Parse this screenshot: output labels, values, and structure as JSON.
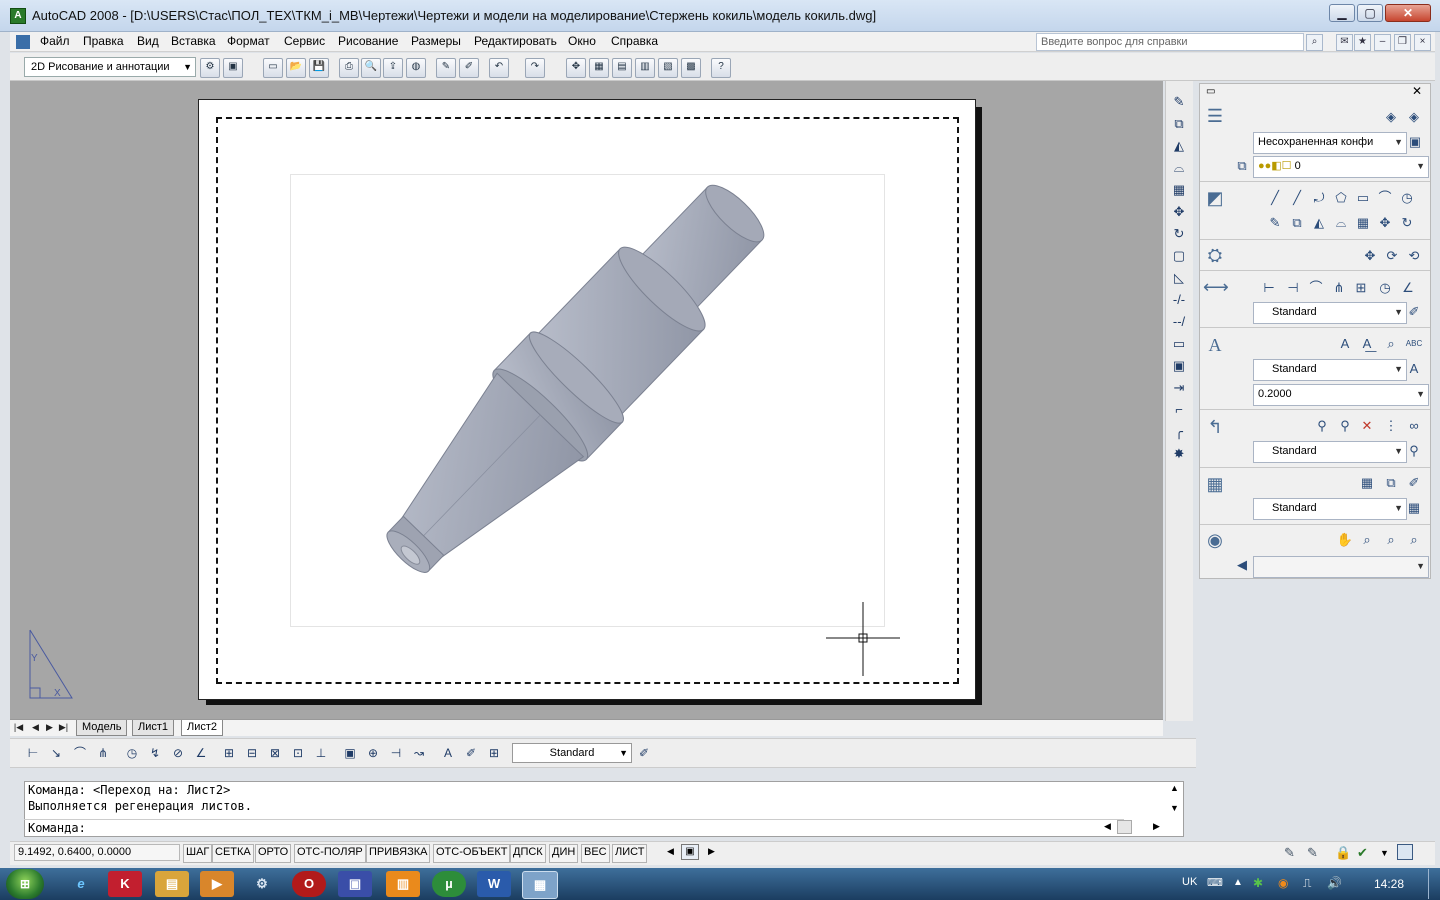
{
  "window": {
    "title": "AutoCAD 2008 - [D:\\USERS\\Стас\\ПОЛ_ТЕХ\\ТКМ_i_МВ\\Чертежи\\Чертежи и модели на моделирование\\Стержень кокиль\\модель кокиль.dwg]",
    "app_icon": "autocad-icon",
    "minimize_label": "▁",
    "maximize_label": "▢",
    "close_label": "✕"
  },
  "menu": {
    "items": [
      "Файл",
      "Правка",
      "Вид",
      "Вставка",
      "Формат",
      "Сервис",
      "Рисование",
      "Размеры",
      "Редактировать",
      "Окно",
      "Справка"
    ]
  },
  "help": {
    "placeholder": "Введите вопрос для справки"
  },
  "toolbar": {
    "workspace": "2D Рисование и аннотации"
  },
  "layout_tabs": {
    "tabs": [
      "Модель",
      "Лист1",
      "Лист2"
    ],
    "active": "Лист2"
  },
  "dimension_toolbar": {
    "style": "Standard"
  },
  "dashboard": {
    "layer_state": "Несохраненная конфи",
    "current_layer": "0",
    "dim_style": "Standard",
    "text_style": "Standard",
    "text_height": "0.2000",
    "mleader_style": "Standard",
    "table_style": "Standard"
  },
  "command": {
    "line1": "Команда:  <Переход на: Лист2>",
    "line2": "Выполняется регенерация листов.",
    "prompt": "Команда:"
  },
  "status": {
    "coords": "9.1492, 0.6400, 0.0000",
    "buttons": [
      "ШАГ",
      "СЕТКА",
      "ОРТО",
      "ОТС-ПОЛЯР",
      "ПРИВЯЗКА",
      "ОТС-ОБЪЕКТ",
      "ДПСК",
      "ДИН",
      "ВЕС",
      "ЛИСТ"
    ]
  },
  "taskbar": {
    "lang": "UK",
    "time": "14:28"
  },
  "colors": {
    "model_fill": "#a9aebc",
    "paper_background": "#a6a6a6"
  }
}
